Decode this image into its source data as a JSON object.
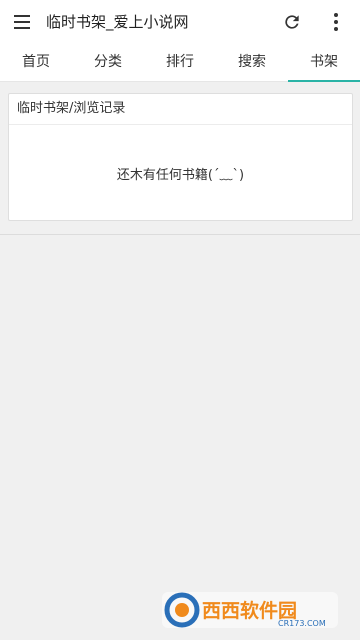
{
  "appbar": {
    "title": "临时书架_爱上小说网",
    "menu_icon": "hamburger-menu-icon",
    "refresh_icon": "refresh-icon",
    "more_icon": "more-vertical-icon"
  },
  "tabs": [
    {
      "label": "首页"
    },
    {
      "label": "分类"
    },
    {
      "label": "排行"
    },
    {
      "label": "搜索"
    },
    {
      "label": "书架",
      "active": true
    }
  ],
  "bookshelf": {
    "title": "临时书架/浏览记录",
    "empty_message": "还木有任何书籍(´﹏`)"
  },
  "watermark": {
    "brand": "西西软件园",
    "domain": "CR173.COM"
  },
  "colors": {
    "accent": "#2ab3a6",
    "background": "#f0f0f0"
  }
}
